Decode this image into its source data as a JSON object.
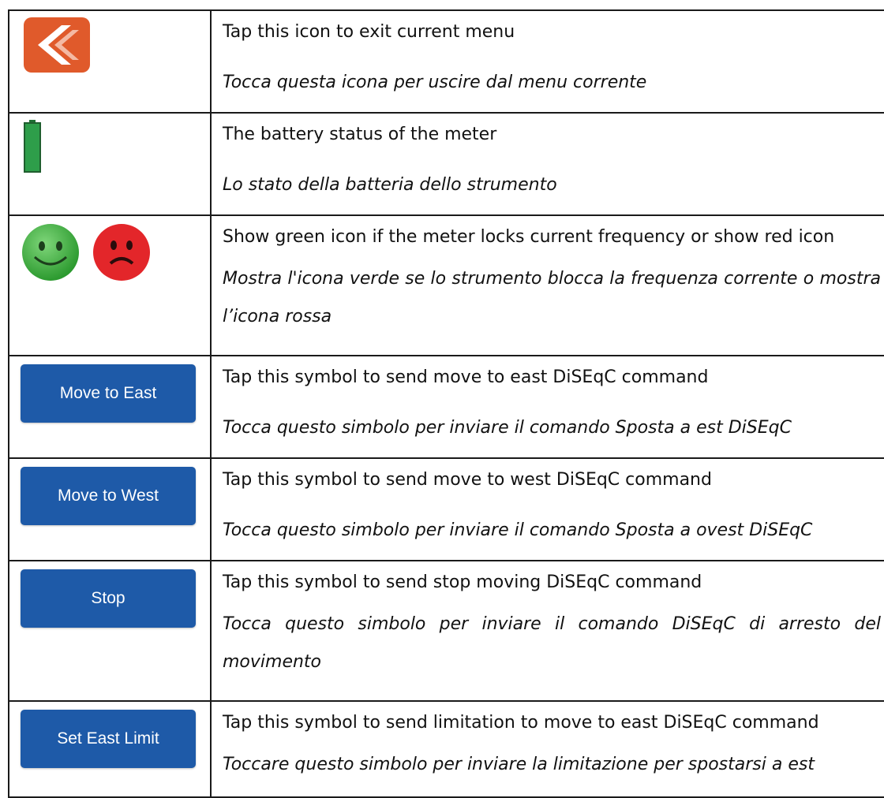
{
  "rows": [
    {
      "icon": "back-arrow-icon",
      "en": "Tap this icon to exit current menu",
      "it": "Tocca questa icona per uscire dal menu corrente"
    },
    {
      "icon": "battery-icon",
      "en": "The battery status of the meter",
      "it": "Lo stato della batteria dello strumento"
    },
    {
      "icon": "smiley-icons",
      "en": "Show green icon if the meter locks current frequency or show red icon",
      "it": "Mostra l'icona verde se lo strumento blocca la frequenza corrente o mostra l’icona rossa"
    },
    {
      "button": "Move to East",
      "en": "Tap this symbol to send move to east DiSEqC command",
      "it": "Tocca questo simbolo per inviare il comando Sposta a est DiSEqC"
    },
    {
      "button": "Move to West",
      "en": "Tap this symbol to send move to west DiSEqC command",
      "it": "Tocca questo simbolo per inviare il comando Sposta a ovest DiSEqC"
    },
    {
      "button": "Stop",
      "en": "Tap this symbol to send stop moving DiSEqC command",
      "it": "Tocca questo simbolo per inviare il comando DiSEqC di arresto del movimento"
    },
    {
      "button": "Set East Limit",
      "en": "Tap this symbol to send limitation to move to east DiSEqC command",
      "it": "Toccare questo simbolo per inviare la limitazione per spostarsi a est"
    }
  ],
  "colors": {
    "button_blue": "#1e5aa8",
    "back_orange": "#e05a2b",
    "battery_green": "#2e9e4a",
    "smile_green": "#3aaa35",
    "frown_red": "#e3262a"
  }
}
